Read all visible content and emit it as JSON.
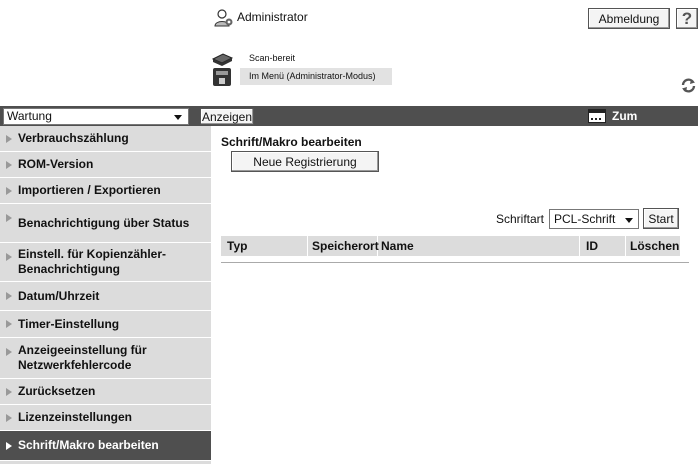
{
  "header": {
    "user_label": "Administrator",
    "logout_label": "Abmeldung",
    "help_label": "?",
    "status": [
      {
        "text": "Scan-bereit",
        "icon": "scanner-icon"
      },
      {
        "text": "Im Menü (Administrator-Modus)",
        "icon": "printer-icon"
      }
    ]
  },
  "toolbar": {
    "category_value": "Wartung",
    "show_label": "Anzeigen",
    "main_menu_label": "Zum Hauptmenü"
  },
  "sidebar": {
    "items": [
      {
        "label": "Verbrauchszählung"
      },
      {
        "label": "ROM-Version"
      },
      {
        "label": "Importieren / Exportieren"
      },
      {
        "label": "Benachrichtigung über Status"
      },
      {
        "label": "Einstell. für Kopienzähler-Benachrichtigung"
      },
      {
        "label": "Datum/Uhrzeit"
      },
      {
        "label": "Timer-Einstellung"
      },
      {
        "label": "Anzeigeeinstellung für Netzwerkfehlercode"
      },
      {
        "label": "Zurücksetzen"
      },
      {
        "label": "Lizenzeinstellungen"
      },
      {
        "label": "Schrift/Makro bearbeiten",
        "active": true
      }
    ]
  },
  "main": {
    "title": "Schrift/Makro bearbeiten",
    "new_registration_label": "Neue Registrierung",
    "font_type_label": "Schriftart",
    "font_type_value": "PCL-Schrift",
    "start_label": "Start",
    "table_columns": [
      "Typ",
      "Speicherort",
      "Name",
      "ID",
      "Löschen"
    ]
  },
  "colors": {
    "bar": "#4f4f4f",
    "sidebar": "#dcdcdc",
    "active_item": "#4f4f4f"
  }
}
